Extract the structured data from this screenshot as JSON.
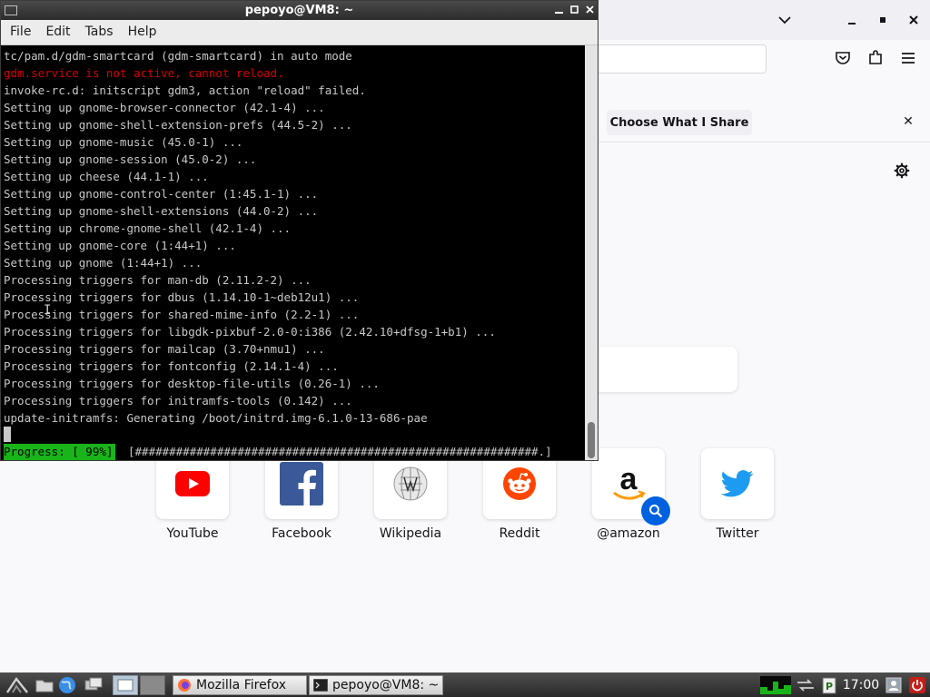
{
  "firefox": {
    "share_button": "Choose What I Share",
    "close_glyph": "✕",
    "top_sites": [
      {
        "label": "YouTube",
        "icon": "youtube-icon"
      },
      {
        "label": "Facebook",
        "icon": "facebook-icon"
      },
      {
        "label": "Wikipedia",
        "icon": "wikipedia-icon"
      },
      {
        "label": "Reddit",
        "icon": "reddit-icon"
      },
      {
        "label": "@amazon",
        "icon": "amazon-icon"
      },
      {
        "label": "Twitter",
        "icon": "twitter-icon"
      }
    ],
    "colors": {
      "youtube": "#ff0000",
      "facebook": "#1877f2",
      "reddit": "#ff4500",
      "twitter": "#1d9bf0",
      "search_badge": "#0061e0"
    }
  },
  "terminal": {
    "title": "pepoyo@VM8: ~",
    "menu": [
      "File",
      "Edit",
      "Tabs",
      "Help"
    ],
    "lines": [
      {
        "text": "tc/pam.d/gdm-smartcard (gdm-smartcard) in auto mode",
        "error": false
      },
      {
        "text": "gdm.service is not active, cannot reload.",
        "error": true
      },
      {
        "text": "invoke-rc.d: initscript gdm3, action \"reload\" failed.",
        "error": false
      },
      {
        "text": "Setting up gnome-browser-connector (42.1-4) ...",
        "error": false
      },
      {
        "text": "Setting up gnome-shell-extension-prefs (44.5-2) ...",
        "error": false
      },
      {
        "text": "Setting up gnome-music (45.0-1) ...",
        "error": false
      },
      {
        "text": "Setting up gnome-session (45.0-2) ...",
        "error": false
      },
      {
        "text": "Setting up cheese (44.1-1) ...",
        "error": false
      },
      {
        "text": "Setting up gnome-control-center (1:45.1-1) ...",
        "error": false
      },
      {
        "text": "Setting up gnome-shell-extensions (44.0-2) ...",
        "error": false
      },
      {
        "text": "Setting up chrome-gnome-shell (42.1-4) ...",
        "error": false
      },
      {
        "text": "Setting up gnome-core (1:44+1) ...",
        "error": false
      },
      {
        "text": "Setting up gnome (1:44+1) ...",
        "error": false
      },
      {
        "text": "Processing triggers for man-db (2.11.2-2) ...",
        "error": false
      },
      {
        "text": "Processing triggers for dbus (1.14.10-1~deb12u1) ...",
        "error": false
      },
      {
        "text": "Processing triggers for shared-mime-info (2.2-1) ...",
        "error": false
      },
      {
        "text": "Processing triggers for libgdk-pixbuf-2.0-0:i386 (2.42.10+dfsg-1+b1) ...",
        "error": false
      },
      {
        "text": "Processing triggers for mailcap (3.70+nmu1) ...",
        "error": false
      },
      {
        "text": "Processing triggers for fontconfig (2.14.1-4) ...",
        "error": false
      },
      {
        "text": "Processing triggers for desktop-file-utils (0.26-1) ...",
        "error": false
      },
      {
        "text": "Processing triggers for initramfs-tools (0.142) ...",
        "error": false
      },
      {
        "text": "update-initramfs: Generating /boot/initrd.img-6.1.0-13-686-pae",
        "error": false
      }
    ],
    "progress_label": "Progress: [ 99%]",
    "progress_bar": "[###########################################################.]",
    "progress_percent": 99,
    "colors": {
      "error": "#d40000",
      "progress": "#19b419",
      "text": "#c8c8c8"
    }
  },
  "taskbar": {
    "tasks": [
      {
        "label": "Mozilla Firefox",
        "icon": "firefox-icon"
      },
      {
        "label": "pepoyo@VM8: ~",
        "icon": "terminal-icon"
      }
    ],
    "clock": "17:00"
  }
}
